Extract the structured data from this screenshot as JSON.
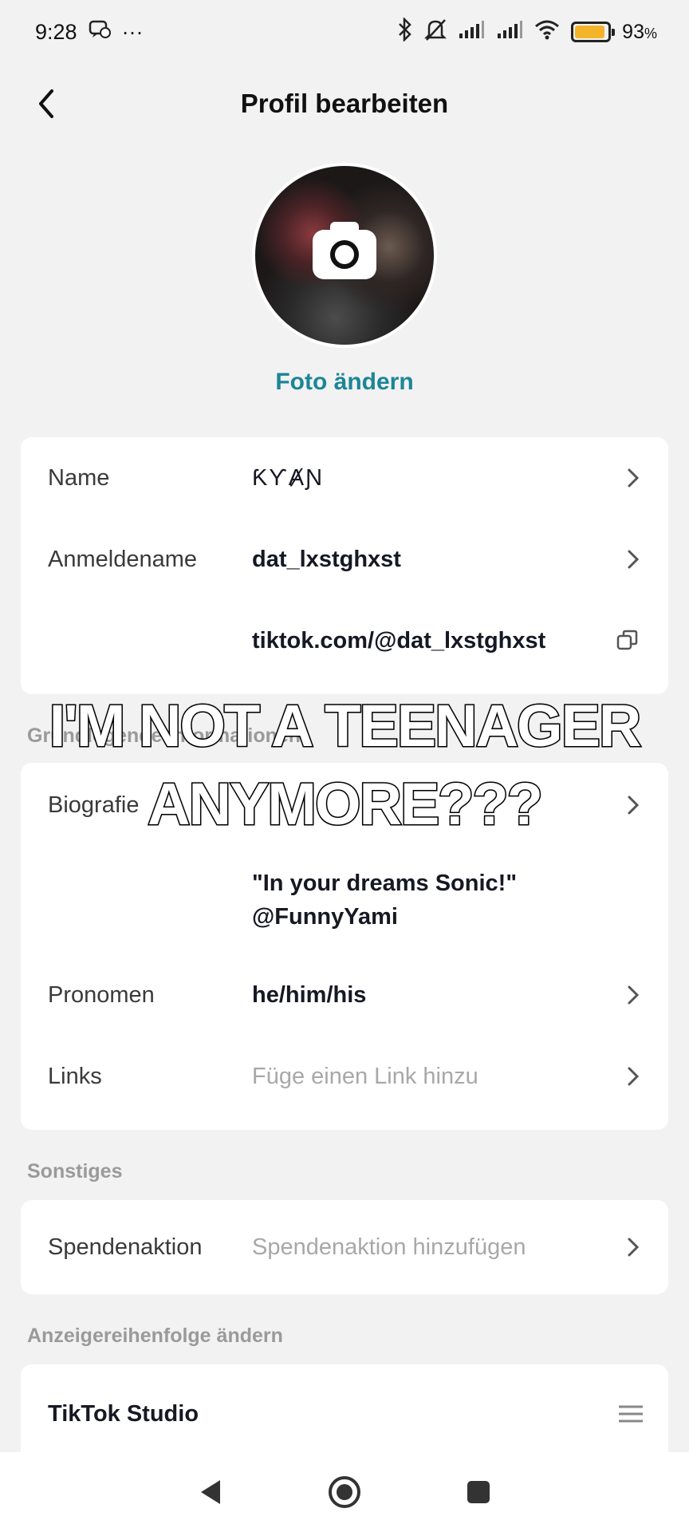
{
  "status_bar": {
    "time": "9:28",
    "dots": "···",
    "battery_percent": "93",
    "battery_unit": "%",
    "battery_level": 0.93,
    "icons": [
      "message-icon",
      "bluetooth-icon",
      "mute-icon",
      "signal-icon",
      "signal-icon",
      "wifi-icon",
      "battery-icon"
    ]
  },
  "header": {
    "title": "Profil bearbeiten"
  },
  "profile": {
    "change_photo": "Foto ändern"
  },
  "basic_card": {
    "name_label": "Name",
    "name_value": "ƘƳȺƝ",
    "username_label": "Anmeldename",
    "username_value": "dat_lxstghxst",
    "link_value": "tiktok.com/@dat_lxstghxst"
  },
  "about_section": {
    "title": "Grundlegende Informationen",
    "bio_label": "Biografie",
    "bio_line1": "\"In your dreams Sonic!\"",
    "bio_line2": "@FunnyYami",
    "pronouns_label": "Pronomen",
    "pronouns_value": "he/him/his",
    "links_label": "Links",
    "links_placeholder": "Füge einen Link hinzu"
  },
  "other_section": {
    "title": "Sonstiges",
    "fundraiser_label": "Spendenaktion",
    "fundraiser_placeholder": "Spendenaktion hinzufügen"
  },
  "order_section": {
    "title": "Anzeigereihenfolge ändern",
    "studio_label": "TikTok Studio"
  },
  "caption": {
    "line1": "I'M NOT A TEENAGER",
    "line2": "ANYMORE???"
  },
  "colors": {
    "accent": "#1b8696",
    "background": "#f2f2f2",
    "battery": "#f4b42a"
  }
}
